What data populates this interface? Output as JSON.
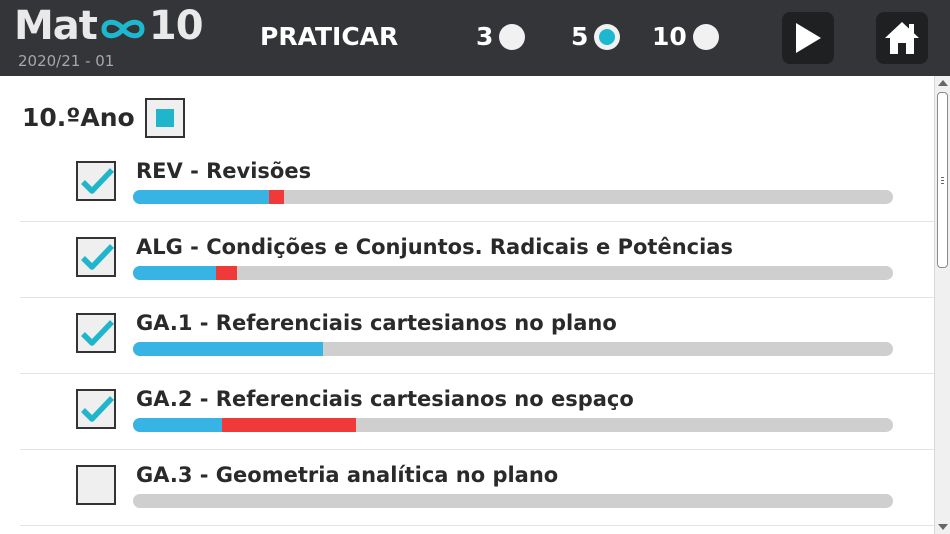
{
  "header": {
    "logo_left": "Mat",
    "logo_symbol": "infinity-icon",
    "logo_right": "10",
    "version": "2020/21 - 01",
    "mode_title": "PRATICAR",
    "question_options": [
      {
        "label": "3",
        "selected": false
      },
      {
        "label": "5",
        "selected": true
      },
      {
        "label": "10",
        "selected": false
      }
    ],
    "play_icon": "play-icon",
    "home_icon": "home-icon"
  },
  "content": {
    "year_label": "10.ºAno",
    "year_checked": "partial",
    "topics": [
      {
        "label": "REV - Revisões",
        "checked": true,
        "progress_correct": 0.179,
        "progress_wrong": 0.02
      },
      {
        "label": "ALG - Condições e Conjuntos. Radicais e Potências",
        "checked": true,
        "progress_correct": 0.109,
        "progress_wrong": 0.028
      },
      {
        "label": "GA.1 - Referenciais cartesianos no plano",
        "checked": true,
        "progress_correct": 0.25,
        "progress_wrong": 0.0
      },
      {
        "label": "GA.2 - Referenciais cartesianos no espaço",
        "checked": true,
        "progress_correct": 0.117,
        "progress_wrong": 0.176
      },
      {
        "label": "GA.3 - Geometria analítica no plano",
        "checked": false,
        "progress_correct": 0.0,
        "progress_wrong": 0.0
      }
    ]
  },
  "colors": {
    "header_bg": "#333538",
    "accent": "#1db8d0",
    "progress_correct": "#37b4e3",
    "progress_wrong": "#f03a3a",
    "progress_track": "#cfcfcf"
  }
}
